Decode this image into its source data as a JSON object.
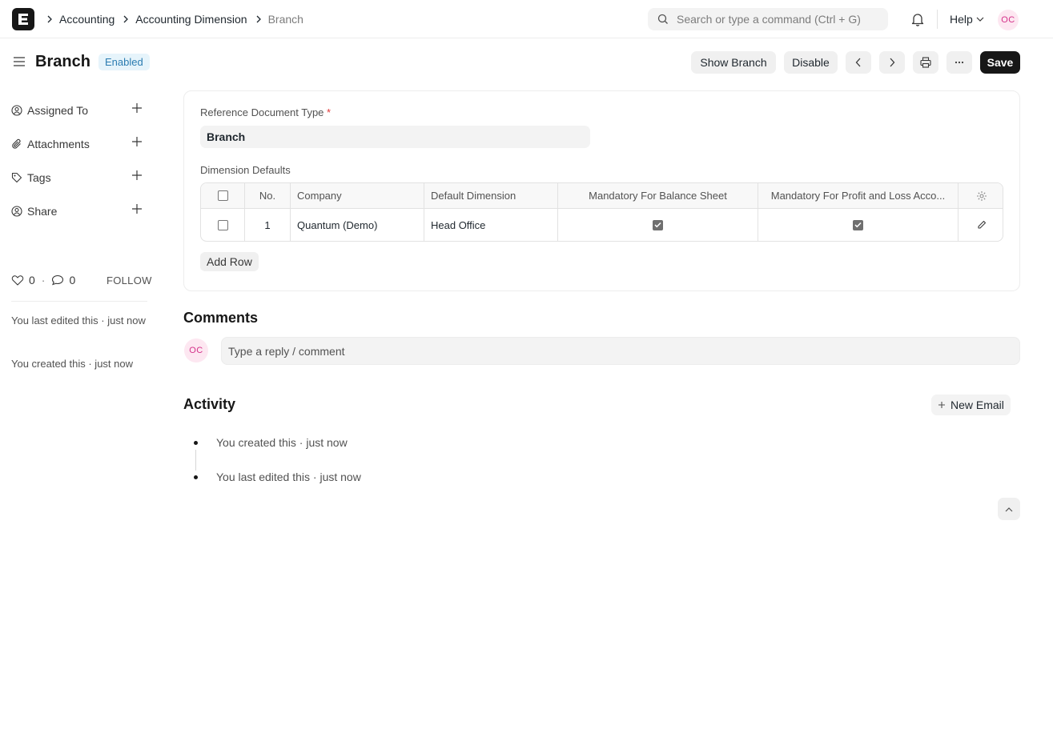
{
  "navbar": {
    "logo_letter": "E",
    "breadcrumbs": [
      "Accounting",
      "Accounting Dimension",
      "Branch"
    ],
    "search_placeholder": "Search or type a command (Ctrl + G)",
    "help_label": "Help",
    "user_initials": "OC"
  },
  "page": {
    "title": "Branch",
    "status": "Enabled",
    "actions": {
      "show_branch": "Show Branch",
      "disable": "Disable",
      "save": "Save"
    }
  },
  "sidebar": {
    "items": [
      {
        "label": "Assigned To",
        "icon": "assign-user-icon"
      },
      {
        "label": "Attachments",
        "icon": "paperclip-icon"
      },
      {
        "label": "Tags",
        "icon": "tag-icon"
      },
      {
        "label": "Share",
        "icon": "share-user-icon"
      }
    ],
    "likes": "0",
    "comments": "0",
    "separator": "·",
    "follow": "FOLLOW",
    "last_edited": "You last edited this · just now",
    "created": "You created this · just now"
  },
  "form": {
    "ref_doc_type_label": "Reference Document Type",
    "required_mark": "*",
    "ref_doc_type_value": "Branch",
    "dimension_defaults_label": "Dimension Defaults",
    "table": {
      "columns": [
        "No.",
        "Company",
        "Default Dimension",
        "Mandatory For Balance Sheet",
        "Mandatory For Profit and Loss Acco..."
      ],
      "rows": [
        {
          "no": "1",
          "company": "Quantum (Demo)",
          "default_dimension": "Head Office",
          "mandatory_balance_sheet": true,
          "mandatory_pnl": true
        }
      ]
    },
    "add_row": "Add Row"
  },
  "comments": {
    "title": "Comments",
    "placeholder": "Type a reply / comment",
    "user_initials": "OC"
  },
  "activity": {
    "title": "Activity",
    "new_email": "New Email",
    "entries": [
      "You created this · just now",
      "You last edited this · just now"
    ]
  },
  "colors": {
    "primary_button": "#171717",
    "badge_bg": "#e6f4fb",
    "badge_text": "#2b7cb1",
    "avatar_bg": "#fde7f1",
    "avatar_text": "#d4318a"
  }
}
